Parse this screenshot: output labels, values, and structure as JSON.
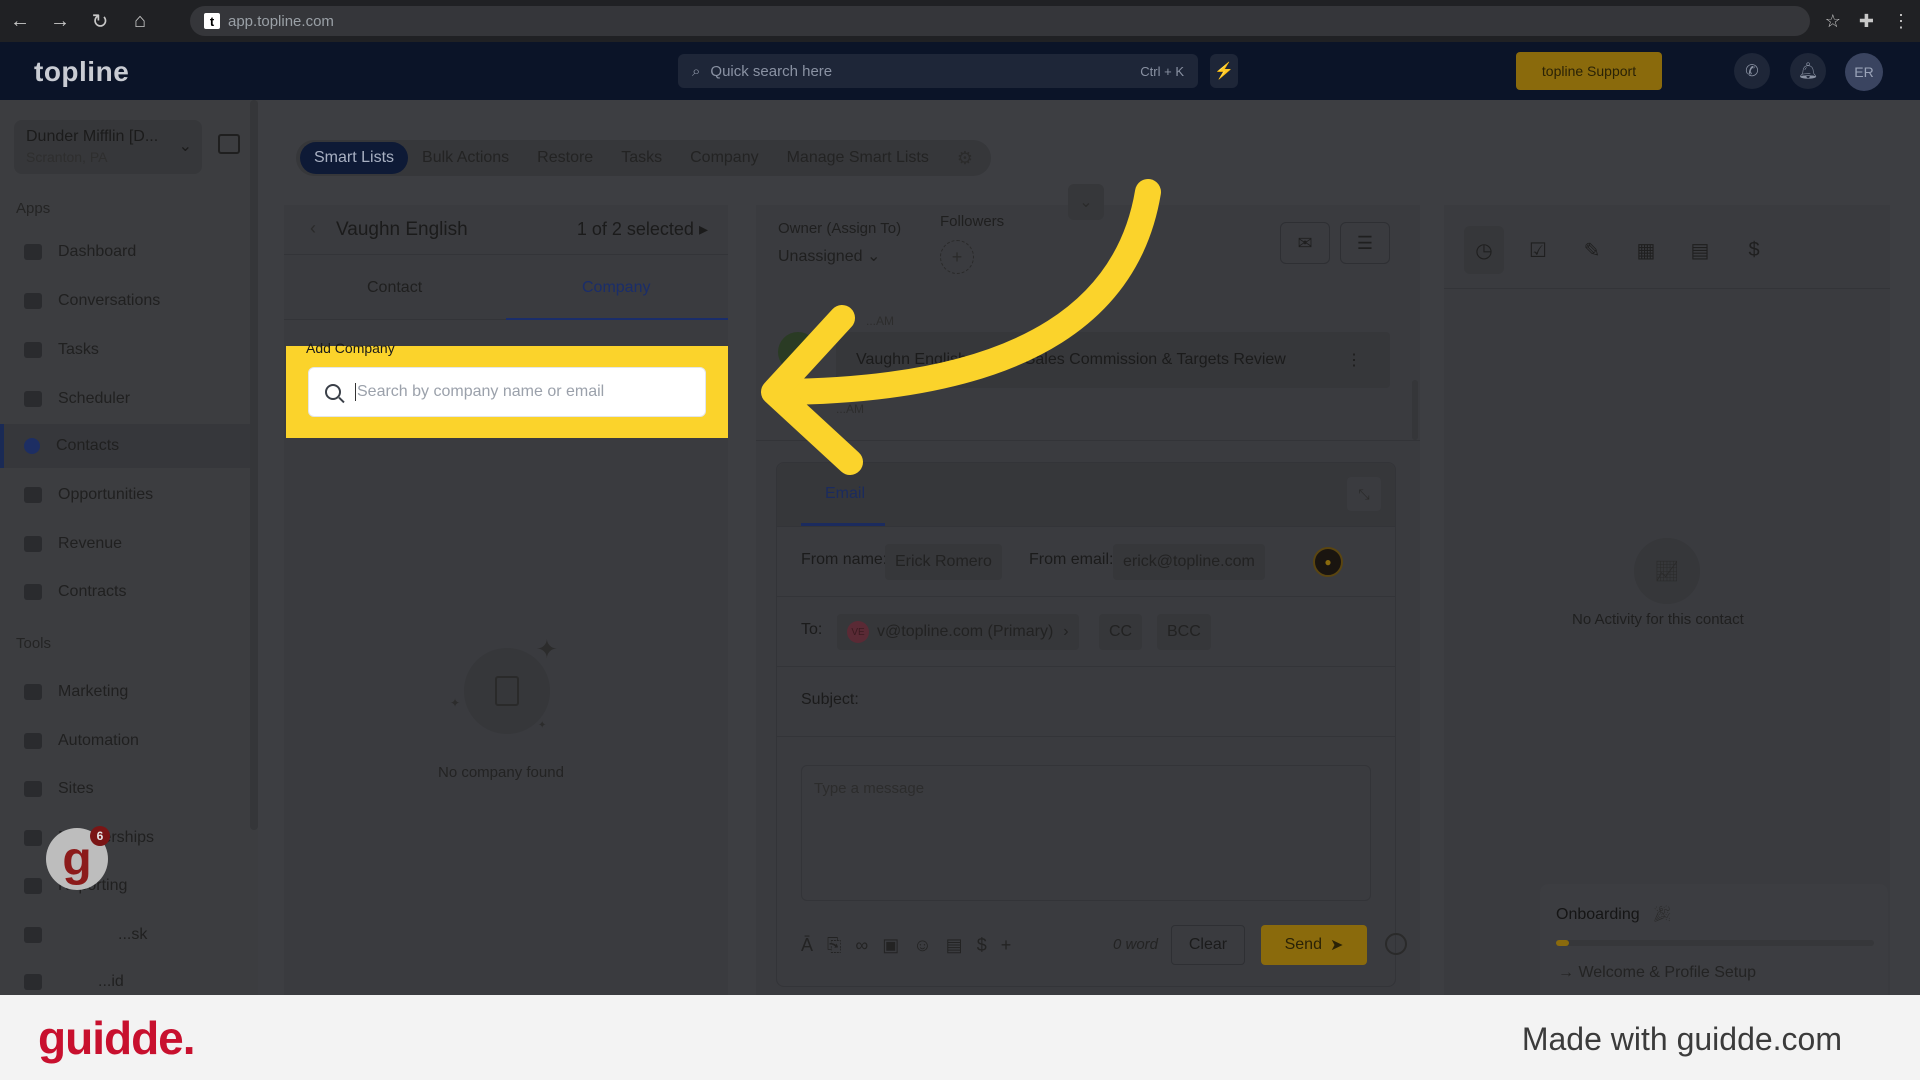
{
  "browser": {
    "url": "app.topline.com",
    "favicon_letter": "t"
  },
  "header": {
    "logo": "topline",
    "search_placeholder": "Quick search here",
    "search_shortcut": "Ctrl + K",
    "support_label": "topline Support",
    "avatar_initials": "ER",
    "accent_color": "#fbd32b"
  },
  "sidebar": {
    "account_name": "Dunder Mifflin [D...",
    "account_location": "Scranton, PA",
    "apps_label": "Apps",
    "tools_label": "Tools",
    "apps": [
      {
        "label": "Dashboard"
      },
      {
        "label": "Conversations"
      },
      {
        "label": "Tasks"
      },
      {
        "label": "Scheduler"
      },
      {
        "label": "Contacts"
      },
      {
        "label": "Opportunities"
      },
      {
        "label": "Revenue"
      },
      {
        "label": "Contracts"
      }
    ],
    "tools": [
      {
        "label": "Marketing"
      },
      {
        "label": "Automation"
      },
      {
        "label": "Sites"
      },
      {
        "label": "Memberships"
      },
      {
        "label": "Reporting"
      },
      {
        "label": "...sk"
      },
      {
        "label": "...id"
      }
    ],
    "badge_count": "6"
  },
  "top_tabs": [
    "Smart Lists",
    "Bulk Actions",
    "Restore",
    "Tasks",
    "Company",
    "Manage Smart Lists"
  ],
  "contact_panel": {
    "name": "Vaughn English",
    "selected": "1 of 2 selected",
    "tab_contact": "Contact",
    "tab_company": "Company",
    "add_company_label": "Add Company",
    "search_placeholder": "Search by company name or email",
    "empty_text": "No company found"
  },
  "center": {
    "owner_label": "Owner (Assign To)",
    "owner_value": "Unassigned",
    "followers_label": "Followers",
    "timeline_time_top": "...AM",
    "timeline_text": "Vaughn English ...pted: Sales Commission & Targets Review",
    "timeline_time_bottom": "...AM",
    "email_tab": "Email",
    "from_name_label": "From name:",
    "from_name_value": "Erick Romero",
    "from_email_label": "From email:",
    "from_email_value": "erick@topline.com",
    "to_label": "To:",
    "to_value": "v@topline.com (Primary)",
    "to_initials": "VE",
    "cc_label": "CC",
    "bcc_label": "BCC",
    "subject_label": "Subject:",
    "message_placeholder": "Type a message",
    "word_count": "0 word",
    "clear_label": "Clear",
    "send_label": "Send"
  },
  "right": {
    "no_activity": "No Activity for this contact",
    "onboarding_title": "Onboarding",
    "onboarding_step": "Welcome & Profile Setup",
    "onboarding_progress_pct": 4
  },
  "footer": {
    "logo": "guidde.",
    "made_with": "Made with guidde.com"
  }
}
